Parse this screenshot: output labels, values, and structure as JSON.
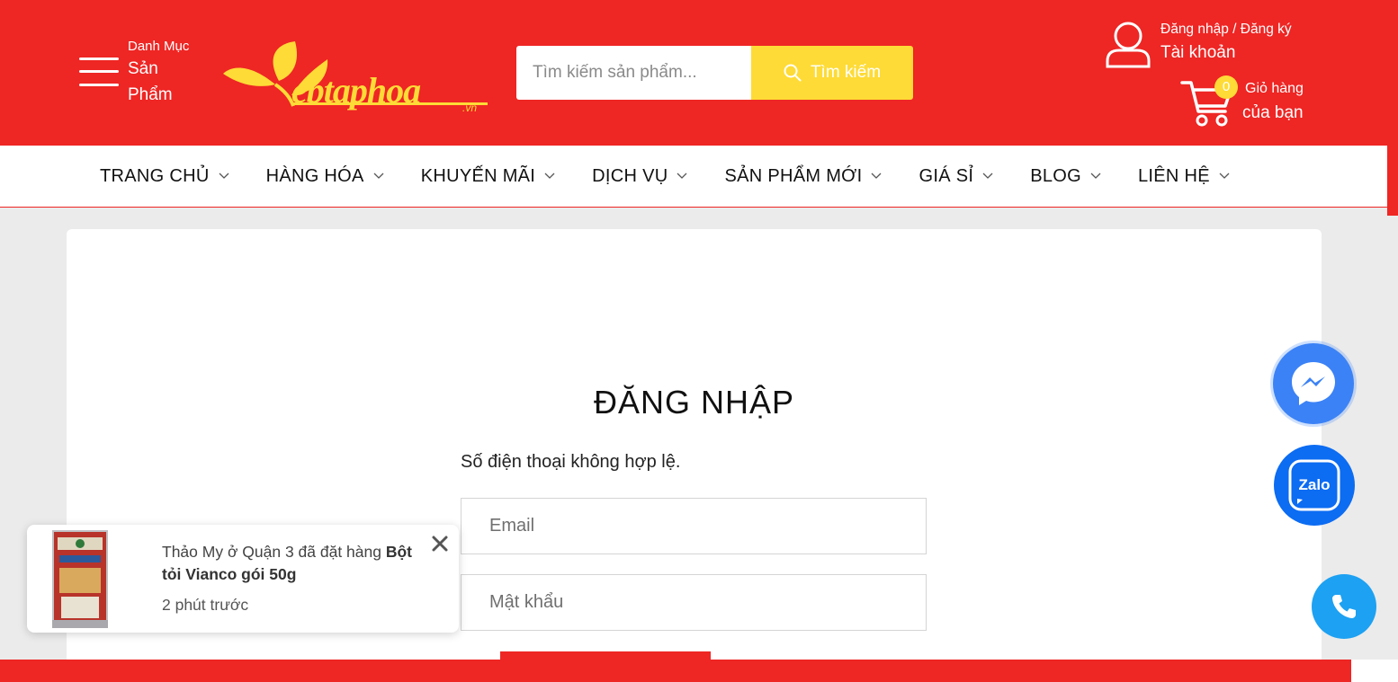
{
  "header": {
    "menu": {
      "small": "Danh Mục",
      "big": "Sản Phẩm"
    },
    "logo_text": "ebtaphoa",
    "logo_suffix": ".vn",
    "search": {
      "placeholder": "Tìm kiếm sản phẩm...",
      "button_label": "Tìm kiếm"
    },
    "account": {
      "small": "Đăng nhập / Đăng ký",
      "big": "Tài khoản"
    },
    "cart": {
      "count": "0",
      "small": "Giỏ hàng",
      "big": "của bạn"
    }
  },
  "nav": {
    "items": [
      {
        "label": "TRANG CHỦ"
      },
      {
        "label": "HÀNG HÓA"
      },
      {
        "label": "KHUYẾN MÃI"
      },
      {
        "label": "DỊCH VỤ"
      },
      {
        "label": "SẢN PHẨM MỚI"
      },
      {
        "label": "GIÁ SỈ"
      },
      {
        "label": "BLOG"
      },
      {
        "label": "LIÊN HỆ"
      }
    ]
  },
  "login": {
    "title": "ĐĂNG NHẬP",
    "error": "Số điện thoại không hợp lệ.",
    "email_placeholder": "Email",
    "password_placeholder": "Mật khẩu"
  },
  "toast": {
    "message_prefix": "Thảo My ở Quận 3 đã đặt hàng ",
    "product_name": "Bột tỏi Vianco gói 50g",
    "time": "2 phút trước"
  },
  "floating": {
    "zalo_label": "Zalo"
  },
  "colors": {
    "brand_red": "#ee2624",
    "accent_yellow": "#fedb36",
    "messenger_blue": "#3b82f6",
    "zalo_blue": "#0c6cf2",
    "phone_blue": "#1da1f2"
  }
}
